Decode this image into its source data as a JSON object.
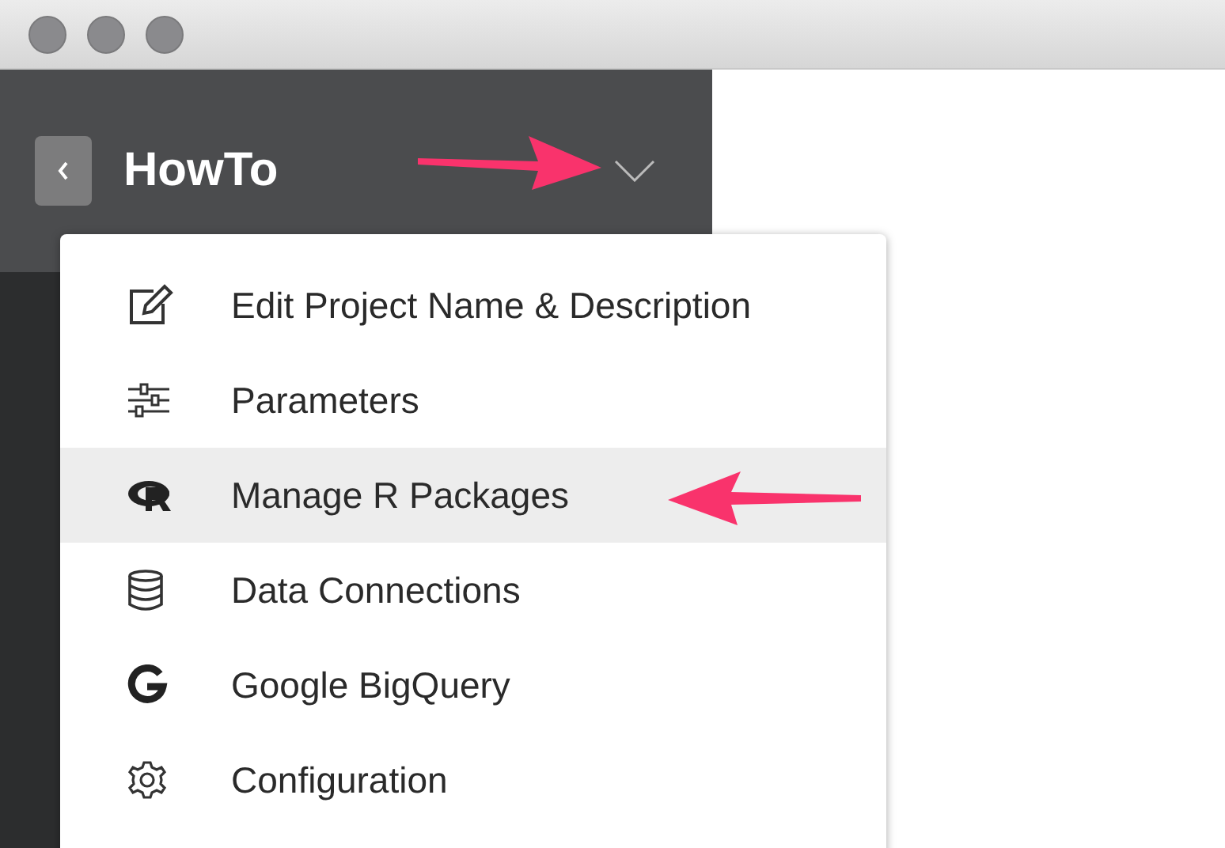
{
  "project": {
    "title": "HowTo"
  },
  "menu": {
    "items": [
      {
        "label": "Edit Project Name & Description",
        "selected": false
      },
      {
        "label": "Parameters",
        "selected": false
      },
      {
        "label": "Manage R Packages",
        "selected": true
      },
      {
        "label": "Data Connections",
        "selected": false
      },
      {
        "label": "Google BigQuery",
        "selected": false
      },
      {
        "label": "Configuration",
        "selected": false
      }
    ]
  }
}
